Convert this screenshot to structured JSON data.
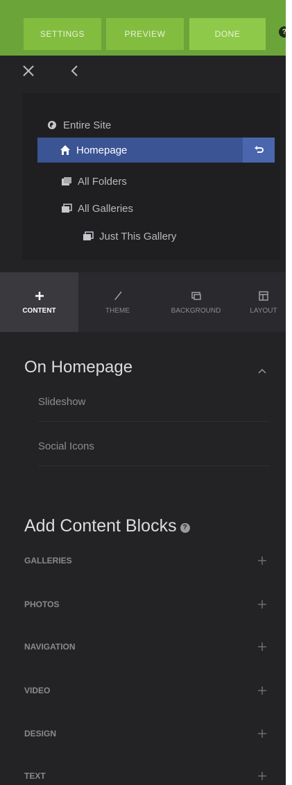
{
  "topbar": {
    "settings_label": "SETTINGS",
    "preview_label": "PREVIEW",
    "done_label": "DONE",
    "help_glyph": "?"
  },
  "tree": {
    "items": [
      {
        "label": "Entire Site",
        "icon": "globe-icon"
      },
      {
        "label": "Homepage",
        "icon": "home-icon",
        "selected": true
      },
      {
        "label": "All Folders",
        "icon": "folders-icon"
      },
      {
        "label": "All Galleries",
        "icon": "galleries-icon"
      },
      {
        "label": "Just This Gallery",
        "icon": "gallery-icon"
      }
    ]
  },
  "tabs": [
    {
      "label": "CONTENT",
      "icon": "plus-icon",
      "active": true
    },
    {
      "label": "THEME",
      "icon": "brush-icon"
    },
    {
      "label": "BACKGROUND",
      "icon": "image-icon"
    },
    {
      "label": "LAYOUT",
      "icon": "layout-icon"
    }
  ],
  "on_homepage": {
    "title": "On Homepage",
    "items": [
      "Slideshow",
      "Social Icons"
    ]
  },
  "add_blocks": {
    "title": "Add Content Blocks",
    "help_glyph": "?",
    "rows": [
      "GALLERIES",
      "PHOTOS",
      "NAVIGATION",
      "VIDEO",
      "DESIGN",
      "TEXT"
    ]
  },
  "colors": {
    "topbar": "#6ba53a",
    "panel": "#232326",
    "selected": "#3b5494"
  }
}
